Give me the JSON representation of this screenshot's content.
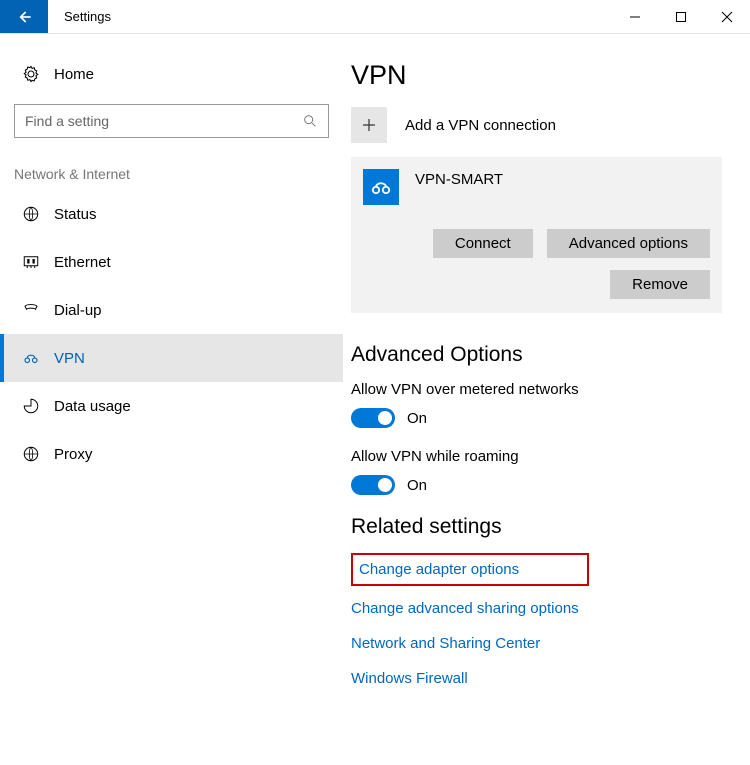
{
  "title": "Settings",
  "search": {
    "placeholder": "Find a setting"
  },
  "home_label": "Home",
  "category": "Network & Internet",
  "nav": [
    {
      "label": "Status",
      "icon": "status-icon"
    },
    {
      "label": "Ethernet",
      "icon": "ethernet-icon"
    },
    {
      "label": "Dial-up",
      "icon": "dialup-icon"
    },
    {
      "label": "VPN",
      "icon": "vpn-icon",
      "active": true
    },
    {
      "label": "Data usage",
      "icon": "datausage-icon"
    },
    {
      "label": "Proxy",
      "icon": "proxy-icon"
    }
  ],
  "page_heading": "VPN",
  "add_connection": "Add a VPN connection",
  "vpn_item": {
    "name": "VPN-SMART",
    "buttons": {
      "connect": "Connect",
      "advanced": "Advanced options",
      "remove": "Remove"
    }
  },
  "advanced_heading": "Advanced Options",
  "option1": {
    "label": "Allow VPN over metered networks",
    "state": "On"
  },
  "option2": {
    "label": "Allow VPN while roaming",
    "state": "On"
  },
  "related_heading": "Related settings",
  "links": {
    "adapter": "Change adapter options",
    "sharing": "Change advanced sharing options",
    "center": "Network and Sharing Center",
    "firewall": "Windows Firewall"
  }
}
